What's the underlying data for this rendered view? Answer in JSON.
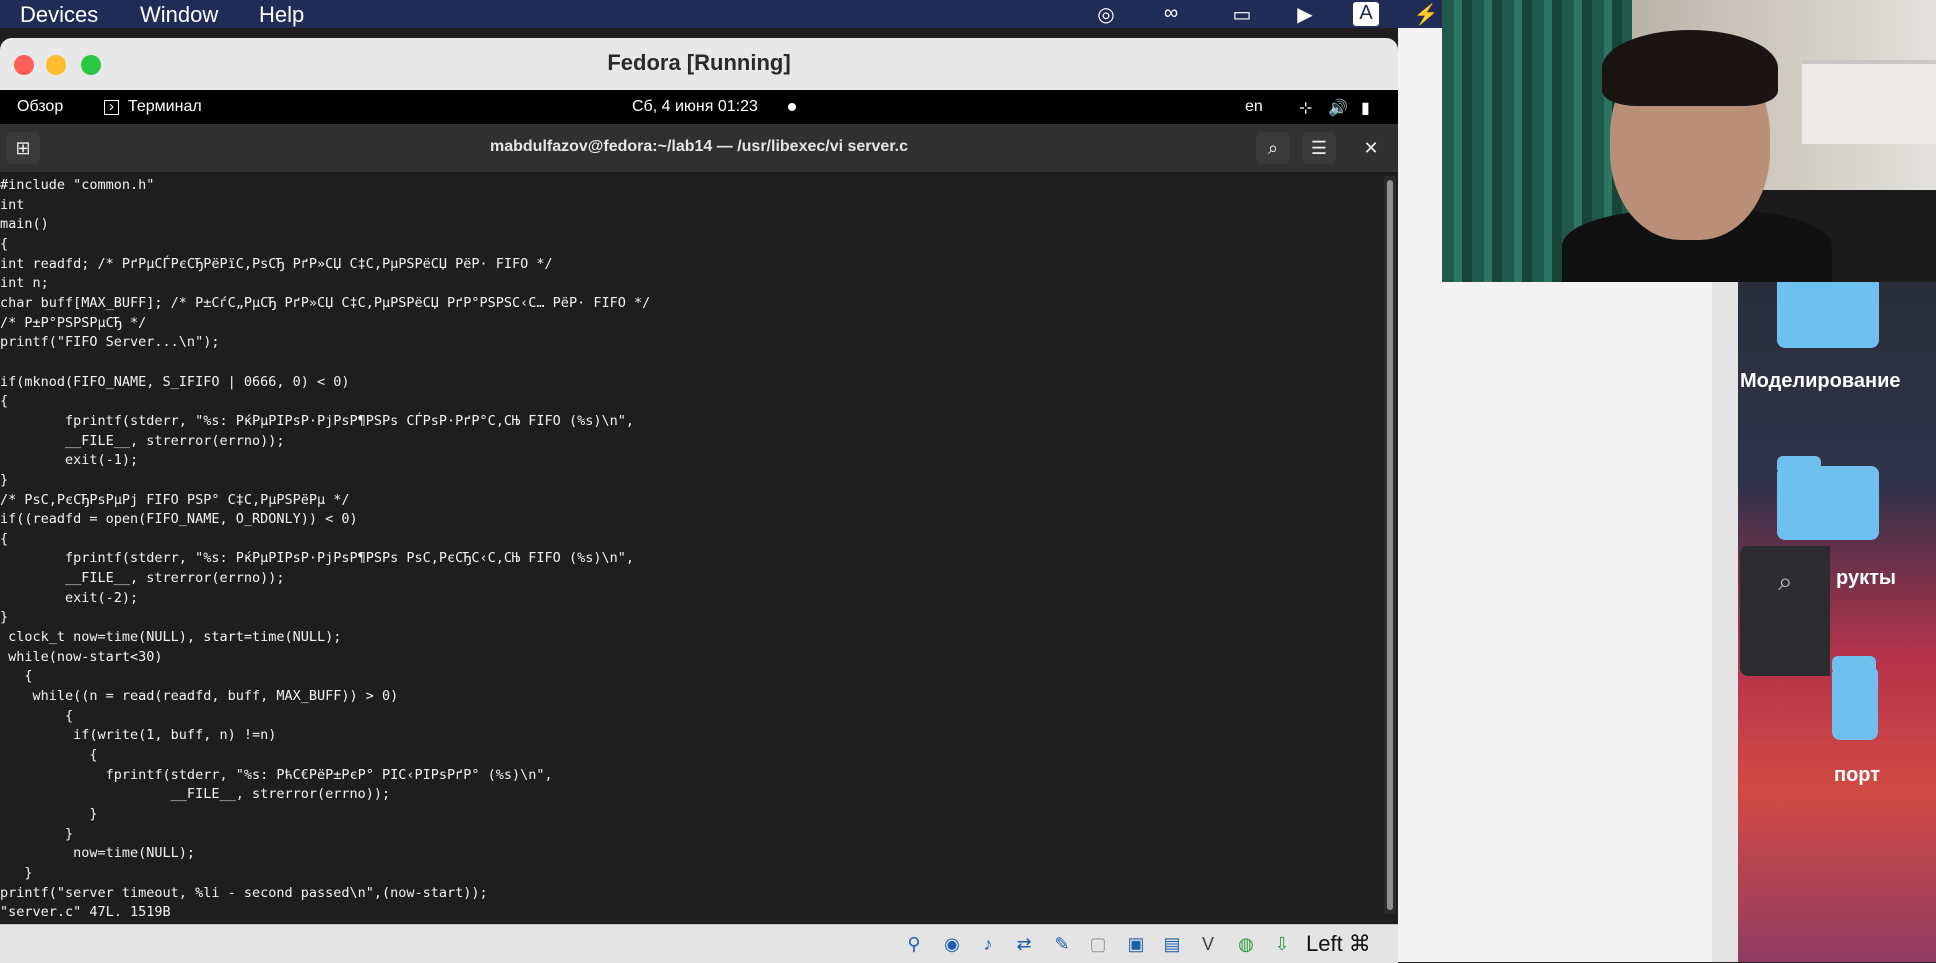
{
  "mac_menubar": {
    "items": [
      "Devices",
      "Window",
      "Help"
    ],
    "tray_icons": [
      "obs-icon",
      "creative-cloud-icon",
      "airplay-icon",
      "play-icon",
      "input-source-icon",
      "battery-icon"
    ],
    "tray_input_label": "A"
  },
  "vbox": {
    "title": "Fedora [Running]",
    "host_key_label": "Left ⌘",
    "status_icons": [
      "usb-icon",
      "optical-drive-icon",
      "audio-icon",
      "network-icon",
      "shared-folders-icon",
      "display-icon",
      "capture-icon",
      "video-memory-icon",
      "cpu-icon",
      "arrow-down-icon"
    ]
  },
  "gnome_bar": {
    "overview": "Обзор",
    "app": "Терминал",
    "clock": "Сб, 4 июня  01:23",
    "lang": "en"
  },
  "terminal": {
    "title": "mabdulfazov@fedora:~/lab14 — /usr/libexec/vi server.c",
    "code": "#include \"common.h\"\nint\nmain()\n{\nint readfd; /* РґРµСЃРєСЂРёРїС‚РѕСЂ РґР»СЏ С‡С‚РµРЅРёСЏ РёР· FIFO */\nint n;\nchar buff[MAX_BUFF]; /* Р±СѓС„РµСЂ РґР»СЏ С‡С‚РµРЅРёСЏ РґР°РЅРЅС‹С… РёР· FIFO */\n/* Р±Р°РЅРЅРµСЂ */\nprintf(\"FIFO Server...\\n\");\n\nif(mknod(FIFO_NAME, S_IFIFO | 0666, 0) < 0)\n{\n        fprintf(stderr, \"%s: РќРµРІРѕР·РјРѕР¶РЅРѕ СЃРѕР·РґР°С‚СЊ FIFO (%s)\\n\",\n        __FILE__, strerror(errno));\n        exit(-1);\n}\n/* РѕС‚РєСЂРѕРµРј FIFO РЅР° С‡С‚РµРЅРёРµ */\nif((readfd = open(FIFO_NAME, O_RDONLY)) < 0)\n{\n        fprintf(stderr, \"%s: РќРµРІРѕР·РјРѕР¶РЅРѕ РѕС‚РєСЂС‹С‚СЊ FIFO (%s)\\n\",\n        __FILE__, strerror(errno));\n        exit(-2);\n}\n clock_t now=time(NULL), start=time(NULL);\n while(now-start<30)\n   {\n    while((n = read(readfd, buff, MAX_BUFF)) > 0)\n        {\n         if(write(1, buff, n) !=n)\n           {\n             fprintf(stderr, \"%s: РћС€РёР±РєР° РІС‹РІРѕРґР° (%s)\\n\",\n                     __FILE__, strerror(errno));\n           }\n        }\n         now=time(NULL);\n   }\nprintf(\"server timeout, %li - second passed\\n\",(now-start));\n\"server.c\" 47L, 1519B"
  },
  "desktop": {
    "folders": [
      "Моделирование",
      "рукты",
      "порт"
    ]
  },
  "colors": {
    "menubar": "#1f2c55",
    "terminal_bg": "#1e1e1e",
    "folder": "#6fc0ef"
  }
}
